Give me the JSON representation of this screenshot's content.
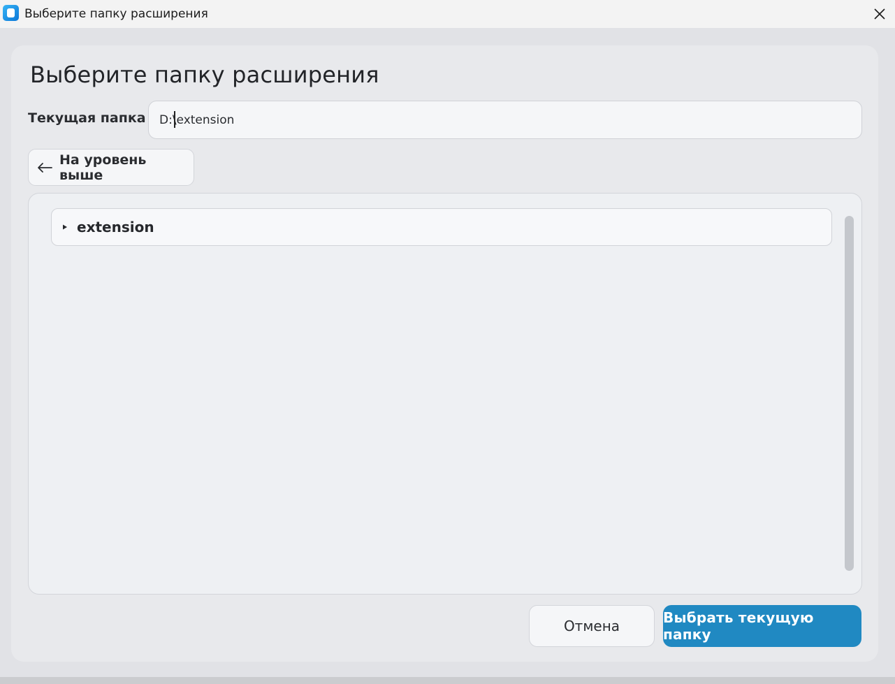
{
  "window": {
    "title": "Выберите папку расширения",
    "close_icon": "close-icon",
    "app_icon": "app-icon"
  },
  "dialog": {
    "heading": "Выберите папку расширения",
    "current_folder_label": "Текущая папка",
    "current_folder_value": "D:\\extension",
    "up_button": {
      "icon": "arrow-left-icon",
      "label": "На уровень выше"
    },
    "folders": [
      {
        "icon": "expand-triangle-icon",
        "name": "extension"
      }
    ],
    "cancel_label": "Отмена",
    "select_label": "Выбрать текущую папку"
  },
  "colors": {
    "accent": "#2089c2",
    "panel_bg": "#e8e9ec",
    "window_bg": "#e1e2e6"
  }
}
